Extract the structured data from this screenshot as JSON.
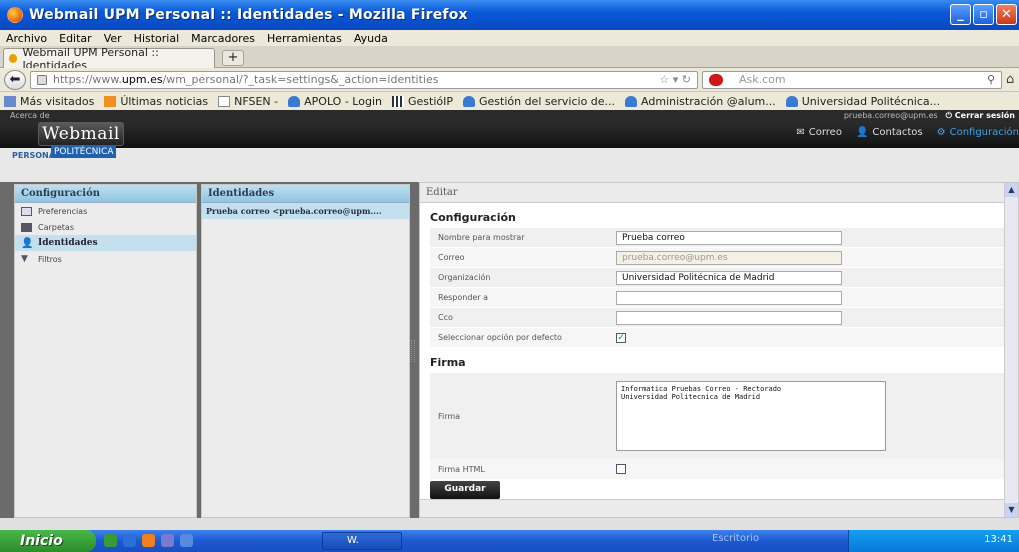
{
  "window": {
    "title": "Webmail UPM Personal :: Identidades - Mozilla Firefox"
  },
  "menu": [
    "Archivo",
    "Editar",
    "Ver",
    "Historial",
    "Marcadores",
    "Herramientas",
    "Ayuda"
  ],
  "tab": {
    "label": "Webmail UPM Personal :: Identidades",
    "new_tab": "+"
  },
  "nav": {
    "url_prefix": "https://www.",
    "url_host": "upm.es",
    "url_rest": "/wm_personal/?_task=settings&_action=identities",
    "search_placeholder": "Ask.com"
  },
  "bookmarks": [
    "Más visitados",
    "Últimas noticias",
    "NFSEN -",
    "APOLO - Login",
    "GestióIP",
    "Gestión del servicio de...",
    "Administración @alum...",
    "Universidad Politécnica..."
  ],
  "site": {
    "about": "Acerca de",
    "user": "prueba.correo@upm.es",
    "logout": "Cerrar sesión",
    "logo": "Webmail",
    "personal": "PERSONAL",
    "politecnica": "POLITÉCNICA",
    "nav": {
      "mail": "Correo",
      "contacts": "Contactos",
      "settings": "Configuración"
    }
  },
  "settings_panel": {
    "title": "Configuración",
    "items": [
      "Preferencias",
      "Carpetas",
      "Identidades",
      "Filtros"
    ]
  },
  "identities_panel": {
    "title": "Identidades",
    "items": [
      "Prueba correo <prueba.correo@upm...."
    ]
  },
  "edit": {
    "header": "Editar",
    "section_config": "Configuración",
    "fields": {
      "name_label": "Nombre para mostrar",
      "name_value": "Prueba correo",
      "email_label": "Correo",
      "email_value": "prueba.correo@upm.es",
      "org_label": "Organización",
      "org_value": "Universidad Politécnica de Madrid",
      "reply_label": "Responder a",
      "reply_value": "",
      "bcc_label": "Cco",
      "bcc_value": "",
      "default_label": "Seleccionar opción por defecto",
      "default_checked": true
    },
    "section_sig": "Firma",
    "sig_label": "Firma",
    "sig_value": "Informatica Pruebas Correo - Rectorado\nUniversidad Politecnica de Madrid",
    "html_sig_label": "Firma HTML",
    "html_sig_checked": false,
    "save": "Guardar"
  },
  "taskbar": {
    "start": "Inicio",
    "window": "W.",
    "desktop": "Escritorio",
    "clock": "13:41"
  },
  "colors": {
    "accent": "#3aa6e8",
    "panel_head": "#8fc4e0",
    "selected": "#c4e0ef",
    "taskbar": "#1c58d0"
  }
}
